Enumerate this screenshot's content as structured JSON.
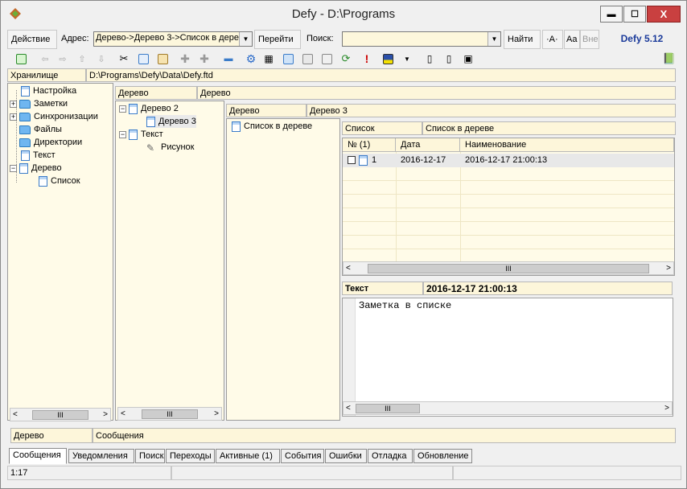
{
  "window": {
    "title": "Defy - D:\\Programs",
    "min": "▬",
    "max": "☐",
    "close": "X"
  },
  "addressbar": {
    "action_label": "Действие",
    "address_label": "Адрес:",
    "address_value": "Дерево->Дерево 3->Список в дере",
    "go_label": "Перейти",
    "search_label": "Поиск:",
    "search_value": "",
    "find_label": "Найти",
    "opt_a": "·A·",
    "opt_case": "Aa",
    "opt_out": "Вне",
    "brand": "Defy 5.12"
  },
  "toolbar_icons": [
    "add-note-icon",
    "back-icon",
    "forward-icon",
    "up-icon",
    "down-icon",
    "cut-icon",
    "copy-icon",
    "paste-icon",
    "add-child-icon",
    "add-sibling-icon",
    "remove-icon",
    "settings-icon",
    "table-icon",
    "doc-blue-icon",
    "doc-gray-icon",
    "doc-copy-icon",
    "refresh-icon",
    "important-icon",
    "color-icon",
    "dropdown-icon",
    "split-v-icon",
    "split-h-icon",
    "layout-icon",
    "book-icon"
  ],
  "storage": {
    "label": "Хранилище",
    "path": "D:\\Programs\\Defy\\Data\\Defy.ftd"
  },
  "left_tree": {
    "items": [
      {
        "label": "Настройка",
        "type": "doc"
      },
      {
        "label": "Заметки",
        "type": "folder",
        "expand": "+"
      },
      {
        "label": "Синхронизации",
        "type": "folder",
        "expand": "+"
      },
      {
        "label": "Файлы",
        "type": "folder"
      },
      {
        "label": "Директории",
        "type": "folder"
      },
      {
        "label": "Текст",
        "type": "doc"
      },
      {
        "label": "Дерево",
        "type": "doc",
        "expand": "−"
      },
      {
        "label": "Список",
        "type": "list"
      }
    ]
  },
  "col2": {
    "hdr1": "Дерево",
    "hdr2": "Дерево",
    "items": [
      {
        "label": "Дерево 2",
        "expand": "−"
      },
      {
        "label": "Дерево 3"
      },
      {
        "label": "Текст",
        "expand": "−"
      },
      {
        "label": "Рисунок"
      }
    ]
  },
  "col3": {
    "hdr1": "Дерево",
    "hdr2": "Дерево 3",
    "item": "Список в дереве"
  },
  "list": {
    "hdr1": "Список",
    "hdr2": "Список в дереве",
    "columns": [
      "№ (1)",
      "Дата",
      "Наименование"
    ],
    "rows": [
      {
        "num": "1",
        "date": "2016-12-17",
        "name": "2016-12-17 21:00:13"
      }
    ]
  },
  "text_panel": {
    "hdr1": "Текст",
    "hdr2": "2016-12-17 21:00:13",
    "content": "Заметка в списке"
  },
  "messages": {
    "hdr1": "Дерево",
    "hdr2": "Сообщения"
  },
  "tabs": [
    "Сообщения",
    "Уведомления",
    "Поиск",
    "Переходы",
    "Активные (1)",
    "События",
    "Ошибки",
    "Отладка",
    "Обновление"
  ],
  "status": {
    "pos": "1:17"
  },
  "scroll": {
    "left": "<",
    "right": ">",
    "thumb": "III"
  }
}
